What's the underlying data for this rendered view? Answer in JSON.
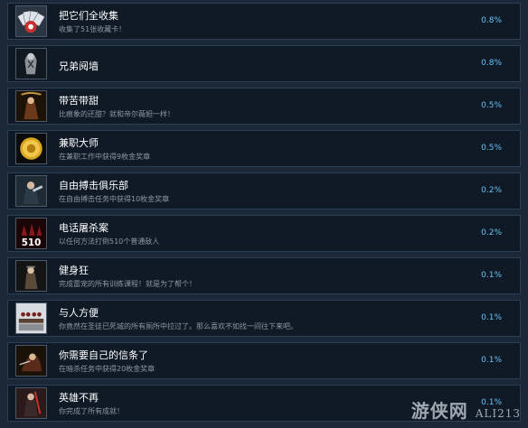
{
  "achievements": [
    {
      "title": "把它们全收集",
      "desc": "收集了51张收藏卡！",
      "percent": "0.8%",
      "icon": "collection-card-icon"
    },
    {
      "title": "兄弟阋墙",
      "desc": "",
      "percent": "0.8%",
      "icon": "brothers-icon"
    },
    {
      "title": "带苦带甜",
      "desc": "比痕象的还甜？就和帝尔薇妲一样！",
      "percent": "0.5%",
      "icon": "bittersweet-icon"
    },
    {
      "title": "兼职大师",
      "desc": "在兼职工作中获得9枚金奖章",
      "percent": "0.5%",
      "icon": "gold-medal-icon"
    },
    {
      "title": "自由搏击俱乐部",
      "desc": "在自由搏击任务中获得10枚金奖章",
      "percent": "0.2%",
      "icon": "fight-club-icon"
    },
    {
      "title": "电话屠杀案",
      "desc": "以任何方法打倒510个普通敌人",
      "percent": "0.2%",
      "icon": "510-icon"
    },
    {
      "title": "健身狂",
      "desc": "完成雷宠的所有训练课程！就是为了帮个！",
      "percent": "0.1%",
      "icon": "fitness-icon"
    },
    {
      "title": "与人方便",
      "desc": "你竟然在圣徒已死城的所有厕所中拉过了。那么喜欢不如找一间往下来吧。",
      "percent": "0.1%",
      "icon": "restroom-icon"
    },
    {
      "title": "你需要自己的信条了",
      "desc": "在暗杀任务中获得20枚金奖章",
      "percent": "0.1%",
      "icon": "creed-icon"
    },
    {
      "title": "英雄不再",
      "desc": "你完成了所有成就！",
      "percent": "0.1%",
      "icon": "no-more-heroes-icon"
    }
  ],
  "watermark": {
    "main": "游侠网",
    "sub": "ALI213"
  }
}
